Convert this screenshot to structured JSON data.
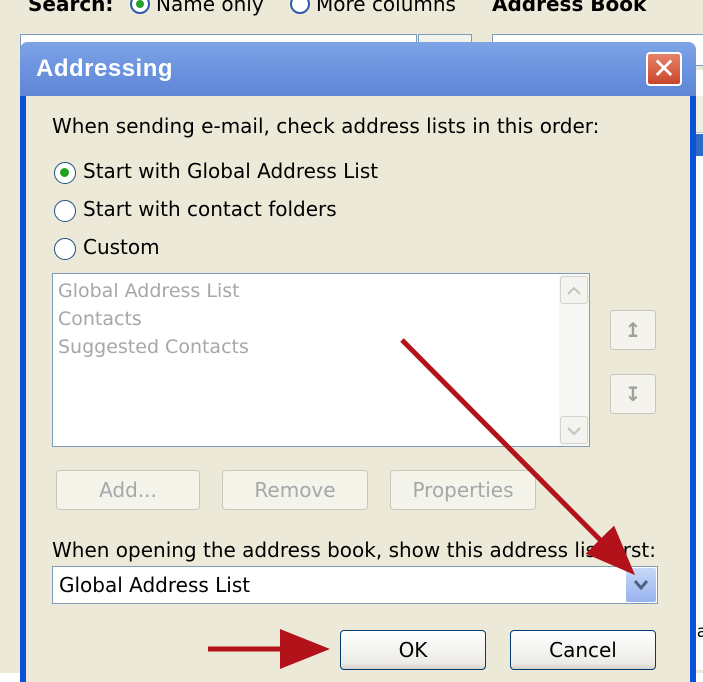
{
  "background_window": {
    "search_label": "Search:",
    "radio_name_only": "Name only",
    "radio_more_columns": "More columns",
    "address_book_label": "Address Book",
    "stray_text": "na"
  },
  "dialog": {
    "title": "Addressing",
    "close_glyph": "✕",
    "instruction": "When sending e-mail, check address lists in this order:",
    "options": [
      {
        "label": "Start with Global Address List",
        "checked": true
      },
      {
        "label": "Start with contact folders",
        "checked": false
      },
      {
        "label": "Custom",
        "checked": false
      }
    ],
    "address_lists": [
      "Global Address List",
      "Contacts",
      "Suggested Contacts"
    ],
    "move_up_glyph": "↥",
    "move_down_glyph": "↧",
    "buttons": {
      "add": "Add...",
      "remove": "Remove",
      "properties": "Properties",
      "ok": "OK",
      "cancel": "Cancel"
    },
    "show_first_label": "When opening the address book, show this address list first:",
    "show_first_value": "Global Address List"
  },
  "colors": {
    "annotation_arrow": "#b3121a",
    "title_bar": "#6b93df",
    "dialog_face": "#ece9d8"
  },
  "icons": {
    "close": "close-icon",
    "scroll_up": "chevron-up-icon",
    "scroll_down": "chevron-down-icon",
    "dropdown": "chevron-down-icon"
  }
}
